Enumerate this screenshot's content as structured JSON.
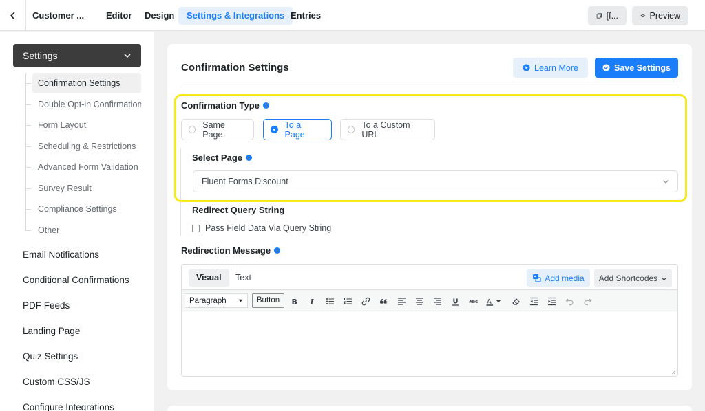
{
  "topbar": {
    "form_name": "Customer ...",
    "tabs": [
      {
        "label": "Editor"
      },
      {
        "label": "Design"
      },
      {
        "label": "Settings & Integrations"
      },
      {
        "label": "Entries"
      }
    ],
    "shortcode_label": "[f...",
    "preview_label": "Preview"
  },
  "sidebar": {
    "settings_label": "Settings",
    "sub_items": [
      {
        "label": "Confirmation Settings"
      },
      {
        "label": "Double Opt-in Confirmation"
      },
      {
        "label": "Form Layout"
      },
      {
        "label": "Scheduling & Restrictions"
      },
      {
        "label": "Advanced Form Validation"
      },
      {
        "label": "Survey Result"
      },
      {
        "label": "Compliance Settings"
      },
      {
        "label": "Other"
      }
    ],
    "main_items": [
      {
        "label": "Email Notifications"
      },
      {
        "label": "Conditional Confirmations"
      },
      {
        "label": "PDF Feeds"
      },
      {
        "label": "Landing Page"
      },
      {
        "label": "Quiz Settings"
      },
      {
        "label": "Custom CSS/JS"
      },
      {
        "label": "Configure Integrations"
      }
    ]
  },
  "main": {
    "title": "Confirmation Settings",
    "learn_more_label": "Learn More",
    "save_label": "Save Settings",
    "confirmation_type_label": "Confirmation Type",
    "radio_options": [
      {
        "label": "Same Page"
      },
      {
        "label": "To a Page"
      },
      {
        "label": "To a Custom URL"
      }
    ],
    "selected_option": "To a Page",
    "select_page_label": "Select Page",
    "select_page_value": "Fluent Forms Discount",
    "redirect_query_label": "Redirect Query String",
    "pass_field_label": "Pass Field Data Via Query String",
    "redirection_message_label": "Redirection Message",
    "editor": {
      "tab_visual": "Visual",
      "tab_text": "Text",
      "add_media_label": "Add media",
      "add_shortcodes_label": "Add Shortcodes",
      "paragraph_label": "Paragraph",
      "button_label": "Button",
      "underline_icon_label": "U",
      "strikethrough_icon_label": "ABC",
      "text_color_icon_label": "A"
    }
  },
  "colors": {
    "accent": "#1a7efb",
    "accent_light": "#e6f0fb",
    "highlight": "#f4ea1f",
    "sidebar_dark": "#3c3c3c"
  }
}
